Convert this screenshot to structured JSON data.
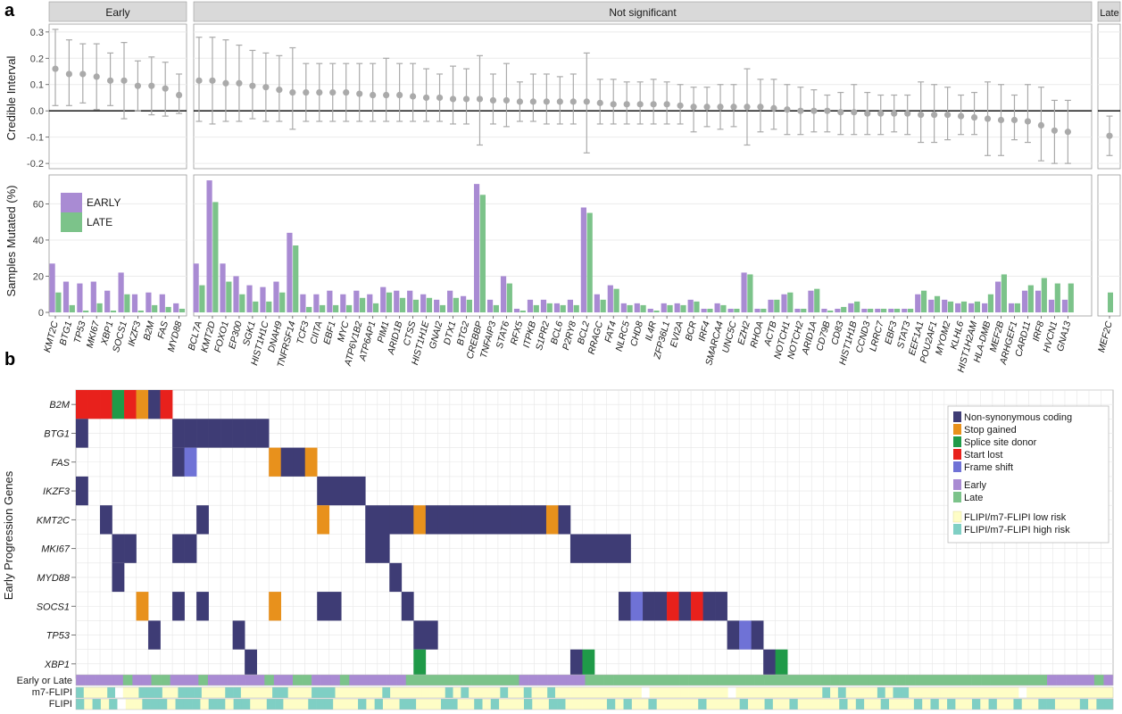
{
  "panel_a_letter": "a",
  "panel_b_letter": "b",
  "facets": [
    "Early",
    "Not significant",
    "Late"
  ],
  "colors": {
    "interval": "#aaaaaa",
    "early": "#a98bd3",
    "late": "#7cc38a",
    "grid": "#ebebeb",
    "strip": "#d9d9d9",
    "noncoding": "#3e3c75",
    "stop": "#e8911c",
    "splice": "#1f9a48",
    "start": "#e8211c",
    "frameshift": "#6f72d6",
    "lowrisk": "#fefdc6",
    "highrisk": "#7fcfc4"
  },
  "chart_data": [
    {
      "type": "scatter",
      "ylabel": "Credible Interval",
      "ylim": [
        -0.22,
        0.33
      ],
      "yticks": [
        "0.3",
        "0.2",
        "0.1",
        "0.0",
        "-0.1",
        "-0.2"
      ],
      "early": {
        "genes": [
          "KMT2C",
          "BTG1",
          "TP53",
          "MKI67",
          "XBP1",
          "SOCS1",
          "IKZF3",
          "B2M",
          "FAS",
          "MYD88"
        ],
        "mid": [
          0.16,
          0.14,
          0.14,
          0.13,
          0.115,
          0.115,
          0.095,
          0.095,
          0.085,
          0.06
        ],
        "lo": [
          0.02,
          0.02,
          0.03,
          0.005,
          0.02,
          -0.03,
          0.0,
          -0.015,
          -0.02,
          -0.01
        ],
        "hi": [
          0.31,
          0.27,
          0.255,
          0.255,
          0.22,
          0.26,
          0.19,
          0.205,
          0.185,
          0.14
        ]
      },
      "notsig": {
        "genes": [
          "BCL7A",
          "KMT2D",
          "FOXO1",
          "EP300",
          "SGK1",
          "HIST1H1C",
          "DNAH9",
          "TNFRSF14",
          "TCF3",
          "CIITA",
          "EBF1",
          "MYC",
          "ATP6V1B2",
          "ATP6AP1",
          "PIM1",
          "ARID1B",
          "CTSS",
          "HIST1H1E",
          "GNAI2",
          "DTX1",
          "BTG2",
          "CREBBP",
          "TNFAIP3",
          "STAT6",
          "RFX5",
          "ITPKB",
          "S1PR2",
          "BCL6",
          "P2RY8",
          "BCL2",
          "RRAGC",
          "FAT4",
          "NLRC5",
          "CHD8",
          "IL4R",
          "ZFP36L1",
          "EVI2A",
          "BCR",
          "IRF4",
          "SMARCA4",
          "UNC5C",
          "EZH2",
          "RHOA",
          "ACTB",
          "NOTCH1",
          "NOTCH2",
          "ARID1A",
          "CD79B",
          "CD83",
          "HIST1H1B",
          "CCND3",
          "LRRC7",
          "EBF3",
          "STAT3",
          "EEF1A1",
          "POU2AF1",
          "MYOM2",
          "KLHL6",
          "HIST1H2AM",
          "HLA-DMB",
          "MEF2B",
          "ARHGEF1",
          "CARD11",
          "IRF8",
          "HVCN1",
          "GNA13"
        ],
        "mid": [
          0.115,
          0.115,
          0.105,
          0.105,
          0.095,
          0.09,
          0.08,
          0.07,
          0.07,
          0.07,
          0.07,
          0.07,
          0.065,
          0.06,
          0.06,
          0.06,
          0.055,
          0.05,
          0.05,
          0.045,
          0.045,
          0.045,
          0.04,
          0.04,
          0.035,
          0.035,
          0.035,
          0.035,
          0.035,
          0.035,
          0.03,
          0.025,
          0.025,
          0.025,
          0.025,
          0.025,
          0.02,
          0.015,
          0.015,
          0.015,
          0.015,
          0.015,
          0.015,
          0.01,
          0.005,
          0.0,
          0.0,
          0.0,
          -0.005,
          -0.005,
          -0.01,
          -0.01,
          -0.01,
          -0.01,
          -0.015,
          -0.015,
          -0.015,
          -0.02,
          -0.025,
          -0.03,
          -0.035,
          -0.035,
          -0.04,
          -0.055,
          -0.075,
          -0.08
        ],
        "lo": [
          -0.04,
          -0.05,
          -0.04,
          -0.04,
          -0.03,
          -0.04,
          -0.04,
          -0.07,
          -0.04,
          -0.04,
          -0.04,
          -0.04,
          -0.04,
          -0.04,
          -0.04,
          -0.04,
          -0.04,
          -0.04,
          -0.04,
          -0.05,
          -0.05,
          -0.13,
          -0.05,
          -0.06,
          -0.04,
          -0.04,
          -0.05,
          -0.05,
          -0.05,
          -0.16,
          -0.05,
          -0.05,
          -0.05,
          -0.05,
          -0.05,
          -0.05,
          -0.05,
          -0.08,
          -0.06,
          -0.07,
          -0.06,
          -0.13,
          -0.08,
          -0.07,
          -0.09,
          -0.09,
          -0.08,
          -0.08,
          -0.09,
          -0.09,
          -0.09,
          -0.09,
          -0.08,
          -0.09,
          -0.12,
          -0.12,
          -0.11,
          -0.09,
          -0.09,
          -0.17,
          -0.17,
          -0.11,
          -0.12,
          -0.19,
          -0.2,
          -0.2
        ],
        "hi": [
          0.28,
          0.28,
          0.27,
          0.25,
          0.23,
          0.22,
          0.21,
          0.24,
          0.18,
          0.18,
          0.18,
          0.18,
          0.18,
          0.18,
          0.2,
          0.18,
          0.18,
          0.16,
          0.14,
          0.17,
          0.16,
          0.21,
          0.14,
          0.18,
          0.11,
          0.14,
          0.14,
          0.13,
          0.14,
          0.22,
          0.12,
          0.12,
          0.11,
          0.11,
          0.12,
          0.11,
          0.1,
          0.09,
          0.09,
          0.1,
          0.1,
          0.16,
          0.12,
          0.12,
          0.1,
          0.09,
          0.08,
          0.06,
          0.07,
          0.1,
          0.07,
          0.06,
          0.06,
          0.06,
          0.11,
          0.1,
          0.09,
          0.06,
          0.07,
          0.11,
          0.1,
          0.06,
          0.1,
          0.09,
          0.04,
          0.04
        ]
      },
      "late": {
        "genes": [
          "MEF2C"
        ],
        "mid": [
          -0.095
        ],
        "lo": [
          -0.17
        ],
        "hi": [
          -0.02
        ]
      }
    },
    {
      "type": "bar",
      "ylabel": "Samples Mutated (%)",
      "ylim": [
        0,
        76
      ],
      "yticks": [
        "60",
        "40",
        "20",
        "0"
      ],
      "legend": [
        "EARLY",
        "LATE"
      ],
      "early_facet_early": [
        27,
        17,
        16,
        17,
        12,
        22,
        10,
        11,
        10,
        5
      ],
      "early_facet_late": [
        11,
        4,
        1,
        5,
        1,
        10,
        1,
        4,
        3,
        2
      ],
      "notsig_early": [
        27,
        73,
        27,
        20,
        15,
        14,
        17,
        44,
        10,
        10,
        12,
        10,
        12,
        10,
        14,
        12,
        12,
        10,
        7,
        12,
        9,
        71,
        7,
        20,
        2,
        7,
        7,
        5,
        7,
        58,
        10,
        15,
        5,
        5,
        2,
        5,
        5,
        7,
        2,
        5,
        2,
        22,
        2,
        7,
        10,
        2,
        12,
        2,
        2,
        5,
        2,
        2,
        2,
        2,
        10,
        7,
        7,
        5,
        5,
        5,
        17,
        5,
        12,
        12,
        7,
        7
      ],
      "notsig_late": [
        15,
        61,
        17,
        10,
        6,
        6,
        11,
        37,
        3,
        4,
        4,
        4,
        8,
        5,
        11,
        8,
        7,
        8,
        4,
        8,
        7,
        65,
        4,
        16,
        1,
        4,
        5,
        4,
        4,
        55,
        7,
        13,
        4,
        4,
        1,
        4,
        4,
        6,
        2,
        4,
        2,
        21,
        2,
        7,
        11,
        2,
        13,
        1,
        3,
        6,
        2,
        2,
        2,
        2,
        12,
        9,
        6,
        6,
        6,
        10,
        21,
        5,
        15,
        19,
        16,
        16
      ],
      "late_facet_early": [
        0
      ],
      "late_facet_late": [
        11
      ]
    }
  ],
  "panel_b": {
    "ylabel": "Early Progression Genes",
    "genes": [
      "B2M",
      "BTG1",
      "FAS",
      "IKZF3",
      "KMT2C",
      "MKI67",
      "MYD88",
      "SOCS1",
      "TP53",
      "XBP1"
    ],
    "bottom_labels": [
      "Early or Late",
      "m7-FLIPI",
      "FLIPI"
    ],
    "n_columns": 86,
    "cells": {
      "B2M": {
        "0": "start",
        "1": "start",
        "2": "start",
        "3": "splice",
        "4": "start",
        "5": "stop",
        "6": "noncoding",
        "7": "start"
      },
      "BTG1": {
        "0": "noncoding",
        "8": "noncoding",
        "9": "noncoding",
        "10": "noncoding",
        "11": "noncoding",
        "12": "noncoding",
        "13": "noncoding",
        "14": "noncoding",
        "15": "noncoding"
      },
      "FAS": {
        "8": "noncoding",
        "9": "frameshift",
        "16": "stop",
        "17": "noncoding",
        "18": "noncoding",
        "19": "stop"
      },
      "IKZF3": {
        "0": "noncoding",
        "20": "noncoding",
        "21": "noncoding",
        "22": "noncoding",
        "23": "noncoding"
      },
      "KMT2C": {
        "2": "noncoding",
        "10": "noncoding",
        "20": "stop",
        "24": "noncoding",
        "25": "noncoding",
        "26": "noncoding",
        "27": "noncoding",
        "28": "stop",
        "29": "noncoding",
        "30": "noncoding",
        "31": "noncoding",
        "32": "noncoding",
        "33": "noncoding",
        "34": "noncoding",
        "35": "noncoding",
        "36": "noncoding",
        "37": "noncoding",
        "38": "noncoding",
        "39": "stop",
        "40": "noncoding"
      },
      "MKI67": {
        "3": "noncoding",
        "4": "noncoding",
        "8": "noncoding",
        "9": "noncoding",
        "24": "noncoding",
        "25": "noncoding",
        "41": "noncoding",
        "42": "noncoding",
        "43": "noncoding",
        "44": "noncoding",
        "45": "noncoding"
      },
      "MYD88": {
        "3": "noncoding",
        "26": "noncoding"
      },
      "SOCS1": {
        "5": "stop",
        "8": "noncoding",
        "10": "noncoding",
        "16": "stop",
        "20": "noncoding",
        "21": "noncoding",
        "27": "noncoding",
        "45": "noncoding",
        "46": "frameshift",
        "47": "noncoding",
        "48": "noncoding",
        "49": "start",
        "50": "noncoding",
        "51": "start",
        "52": "noncoding",
        "53": "noncoding"
      },
      "TP53": {
        "6": "noncoding",
        "13": "noncoding",
        "28": "noncoding",
        "29": "noncoding",
        "54": "noncoding",
        "55": "frameshift",
        "56": "noncoding"
      },
      "XBP1": {
        "14": "noncoding",
        "28": "splice",
        "41": "noncoding",
        "42": "splice",
        "57": "noncoding",
        "58": "splice"
      }
    },
    "early_late": "EEEEELEELLEEELEEEEEELEELLEEELEEEEEELLLLLLLLLLLLEEEEEEELLLLLLLLLLLLLLLLLLLLLLLLLLLLLLLLLLLLLLLLLLLLLLLLLEEEEELE",
    "m7flipi": "HLLLHWLLHHHLLHHHLLLHHLLLLHHLLLHHHLLLLLLHLLLLLLLHLHLLLLHLLHLLHLLLLLLLLLLLWLLLLLLLLLLWLLLLLLLLLLLHLHLLLLHLHHLLLLLLLLLLLLLLWLLLLLLLLLLL",
    "flipi": "HLHLHWLLHHHLHHHLHHLHHLLHHLLLHHHLLLHLHLLHHLLLHHLLHLHLLLHLLHHLLLLLHLHLLHLLLLLHLLLLHLLHLLHLLLLLHLHLLHLLLHLHLHLLHLHLLHLLHHLLLHLHH",
    "legend": {
      "mutations": [
        "Non-synonymous coding",
        "Stop gained",
        "Splice site donor",
        "Start lost",
        "Frame shift"
      ],
      "timing": [
        "Early",
        "Late"
      ],
      "risk": [
        "FLIPI/m7-FLIPI low risk",
        "FLIPI/m7-FLIPI high risk"
      ]
    }
  }
}
